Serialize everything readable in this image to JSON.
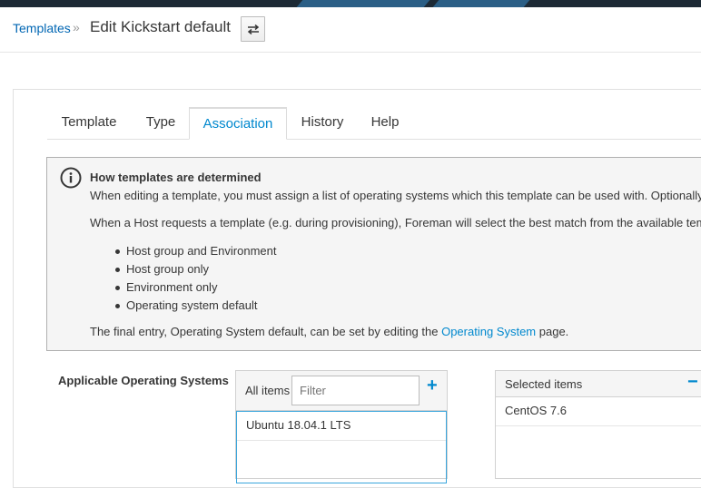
{
  "breadcrumb": {
    "parent": "Templates",
    "separator": "»",
    "current": "Edit Kickstart default"
  },
  "toolbar": {
    "switch_icon": "exchange-icon"
  },
  "tabs": [
    {
      "label": "Template"
    },
    {
      "label": "Type"
    },
    {
      "label": "Association",
      "active": true
    },
    {
      "label": "History"
    },
    {
      "label": "Help"
    }
  ],
  "info": {
    "icon": "info-circle-icon",
    "title": "How templates are determined",
    "line1": "When editing a template, you must assign a list of operating systems which this template can be used with. Optionally, you",
    "line2": "When a Host requests a template (e.g. during provisioning), Foreman will select the best match from the available templat",
    "bullets": [
      "Host group and Environment",
      "Host group only",
      "Environment only",
      "Operating system default"
    ],
    "final_prefix": "The final entry, Operating System default, can be set by editing the ",
    "final_link": "Operating System",
    "final_suffix": " page."
  },
  "os_selector": {
    "label": "Applicable Operating Systems",
    "all_items_label": "All items",
    "filter_placeholder": "Filter",
    "available": [
      "Ubuntu 18.04.1 LTS"
    ],
    "selected_label": "Selected items",
    "selected": [
      "CentOS 7.6"
    ]
  },
  "colors": {
    "accent": "#0088ce",
    "link": "#0066b3",
    "topbar": "#1d2a35"
  }
}
